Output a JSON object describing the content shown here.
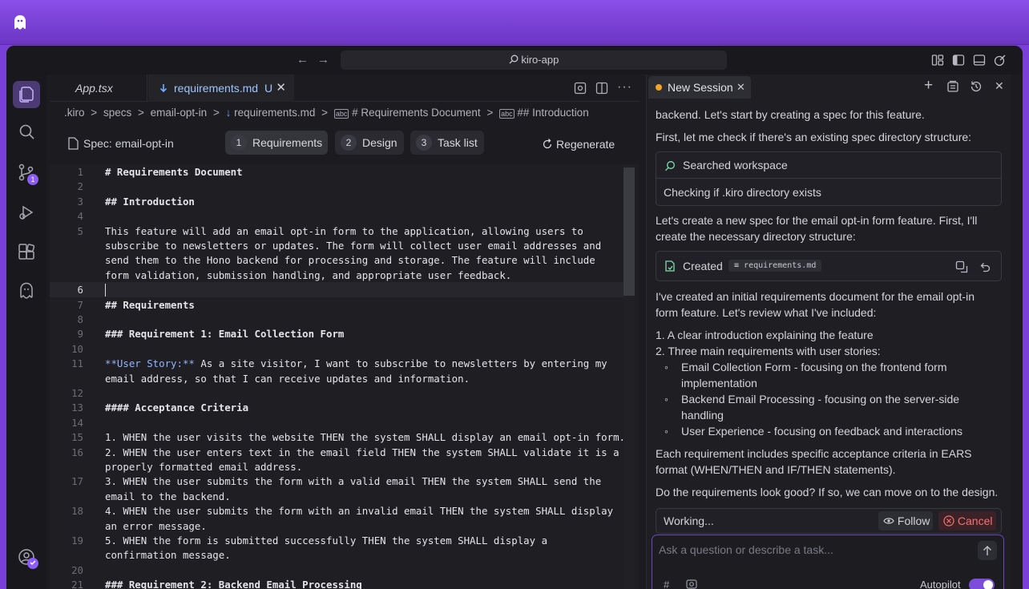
{
  "window": {
    "title": "kiro-app"
  },
  "editor": {
    "tabs": [
      {
        "label": "App.tsx",
        "active": false
      },
      {
        "label": "requirements.md",
        "status": "U",
        "active": true
      }
    ],
    "breadcrumb": [
      ".kiro",
      "specs",
      "email-opt-in",
      "requirements.md",
      "# Requirements Document",
      "## Introduction"
    ],
    "breadcrumb_sep": ">",
    "spec_label": "Spec: email-opt-in",
    "spec_steps": [
      {
        "num": "1",
        "label": "Requirements",
        "active": true
      },
      {
        "num": "2",
        "label": "Design",
        "active": false
      },
      {
        "num": "3",
        "label": "Task list",
        "active": false
      }
    ],
    "regenerate_label": "Regenerate",
    "lines": [
      {
        "n": "1",
        "text": "# Requirements Document",
        "bold": true
      },
      {
        "n": "2",
        "text": ""
      },
      {
        "n": "3",
        "text": "## Introduction",
        "bold": true
      },
      {
        "n": "4",
        "text": ""
      },
      {
        "n": "5",
        "text": "This feature will add an email opt-in form to the application, allowing users to"
      },
      {
        "n": "",
        "text": "subscribe to newsletters or updates. The form will collect user email addresses and"
      },
      {
        "n": "",
        "text": "send them to the Hono backend for processing and storage. The feature will include"
      },
      {
        "n": "",
        "text": "form validation, submission handling, and appropriate user feedback."
      },
      {
        "n": "6",
        "text": ""
      },
      {
        "n": "7",
        "text": "## Requirements",
        "bold": true
      },
      {
        "n": "8",
        "text": ""
      },
      {
        "n": "9",
        "text": "### Requirement 1: Email Collection Form",
        "bold": true
      },
      {
        "n": "10",
        "text": ""
      },
      {
        "n": "11",
        "text": "**User Story:** As a site visitor, I want to subscribe to newsletters by entering my",
        "story": true
      },
      {
        "n": "",
        "text": "email address, so that I can receive updates and information."
      },
      {
        "n": "12",
        "text": ""
      },
      {
        "n": "13",
        "text": "#### Acceptance Criteria",
        "bold": true
      },
      {
        "n": "14",
        "text": ""
      },
      {
        "n": "15",
        "text": "1. WHEN the user visits the website THEN the system SHALL display an email opt-in form."
      },
      {
        "n": "16",
        "text": "2. WHEN the user enters text in the email field THEN the system SHALL validate it is a"
      },
      {
        "n": "",
        "text": "properly formatted email address."
      },
      {
        "n": "17",
        "text": "3. WHEN the user submits the form with a valid email THEN the system SHALL send the"
      },
      {
        "n": "",
        "text": "email to the backend."
      },
      {
        "n": "18",
        "text": "4. WHEN the user submits the form with an invalid email THEN the system SHALL display"
      },
      {
        "n": "",
        "text": "an error message."
      },
      {
        "n": "19",
        "text": "5. WHEN the form is submitted successfully THEN the system SHALL display a"
      },
      {
        "n": "",
        "text": "confirmation message."
      },
      {
        "n": "20",
        "text": ""
      },
      {
        "n": "21",
        "text": "### Requirement 2: Backend Email Processing",
        "bold": true
      }
    ]
  },
  "activity": {
    "source_control_badge": "1"
  },
  "chat": {
    "session_tab": "New Session",
    "intro": "backend. Let's start by creating a spec for this feature.",
    "check": "First, let me check if there's an existing spec directory structure:",
    "searched": "Searched workspace",
    "checking": "Checking if .kiro directory exists",
    "create1": "Let's create a new spec for the email opt-in form feature. First, I'll",
    "create2": "create the necessary directory structure:",
    "created_label": "Created",
    "created_file": "requirements.md",
    "review1": "I've created an initial requirements document for the email opt-in",
    "review2": "form feature. Let's review what I've included:",
    "list1": "1. A clear introduction explaining the feature",
    "list2": "2. Three main requirements with user stories:",
    "sub1a": "Email Collection Form - focusing on the frontend form",
    "sub1b": "implementation",
    "sub2a": "Backend Email Processing - focusing on the server-side",
    "sub2b": "handling",
    "sub3": "User Experience - focusing on feedback and interactions",
    "ears1": "Each requirement includes specific acceptance criteria in EARS",
    "ears2": "format (WHEN/THEN and IF/THEN statements).",
    "question": "Do the requirements look good? If so, we can move on to the design.",
    "working": "Working...",
    "follow": "Follow",
    "cancel": "Cancel",
    "input_placeholder": "Ask a question or describe a task...",
    "autopilot": "Autopilot"
  },
  "colors": {
    "accent": "#8b5cf6",
    "cancel": "#f87171",
    "session_dot": "#f5a524"
  }
}
